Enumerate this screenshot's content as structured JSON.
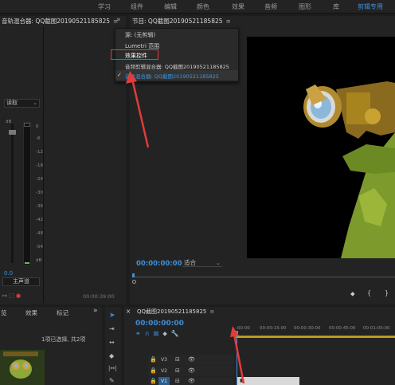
{
  "workspaces": {
    "items": [
      "学习",
      "组件",
      "编辑",
      "颜色",
      "效果",
      "音频",
      "图形",
      "库"
    ],
    "active": "剪辑专用"
  },
  "audio_mixer": {
    "title": "音轨混合器: QQ截图20190521185825",
    "read_mode": "读取",
    "db_scale": [
      "0",
      "-6",
      "-12",
      "-18",
      "-24",
      "-30",
      "-36",
      "-42",
      "-48",
      "-54",
      "dB"
    ],
    "left_value": "0.0",
    "master_label": "主声道",
    "timecode": "00:00:39:00"
  },
  "program_panel": {
    "title": "节目: QQ截图20190521185825",
    "timecode": "00:00:00:00",
    "fit": "适合"
  },
  "menu": {
    "items": [
      "源: (无剪辑)",
      "Lumetri 范围",
      "效果控件",
      "音频剪辑混合器: QQ截图20190521185825",
      "音轨混合器: QQ截图20190521185825"
    ],
    "highlighted_index": 2,
    "checked_index": 4
  },
  "project_panel": {
    "tabs": [
      "览",
      "效果",
      "标记"
    ],
    "selection_info": "1项已选择, 共2项"
  },
  "timeline": {
    "title": "QQ截图20190521185825",
    "timecode": "00:00:00:00",
    "ruler": [
      ":00:00",
      "00:00:15:00",
      "00:00:30:00",
      "00:00:45:00",
      "00:01:00:00"
    ],
    "tracks": [
      "V3",
      "V2",
      "V1"
    ]
  },
  "icons": {
    "play": "play-icon",
    "fx": "tool-icons"
  }
}
